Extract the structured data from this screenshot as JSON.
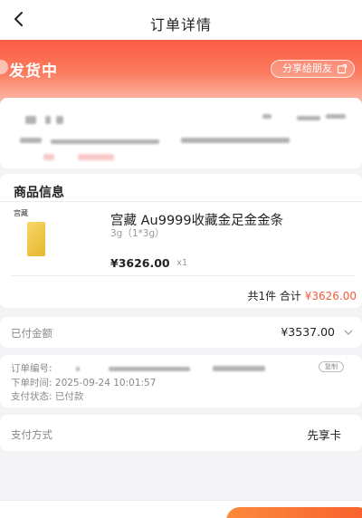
{
  "nav": {
    "title": "订单详情"
  },
  "status": {
    "text": "发货中",
    "share_label": "分享给朋友"
  },
  "goods": {
    "section_title": "商品信息",
    "brand": "宫藏",
    "name": "宫藏 Au9999收藏金足金金条",
    "spec": "3g（1*3g）",
    "price": "¥3626.00",
    "qty": "x1",
    "total_prefix": "共1件 合计",
    "total_amount": "¥3626.00"
  },
  "payment": {
    "paid_label": "已付金额",
    "paid_value": "¥3537.00",
    "method_label": "支付方式",
    "method_value": "先享卡"
  },
  "order_info": {
    "number_label": "订单编号:",
    "copy_label": "复制",
    "time_label": "下单时间:",
    "time_value": "2025-09-24 10:01:57",
    "status_label": "支付状态:",
    "status_value": "已付款"
  },
  "colors": {
    "accent": "#f45a3c",
    "header_gradient_top": "#fb5a42",
    "gold": "#e6b62c"
  }
}
